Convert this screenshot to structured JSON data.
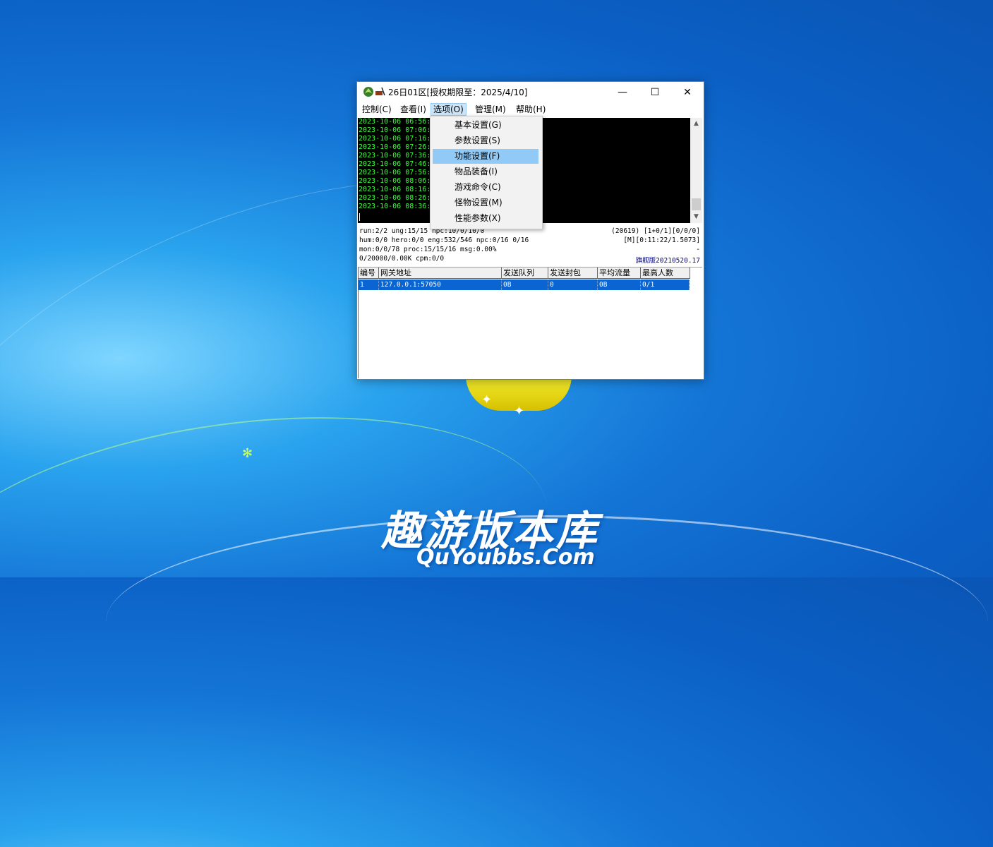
{
  "window": {
    "title": "26日01区[授权期限至：2025/4/10]",
    "minimize": "—",
    "maximize": "☐",
    "close": "✕"
  },
  "menubar": [
    {
      "label": "控制(C)"
    },
    {
      "label": "查看(I)"
    },
    {
      "label": "选项(O)"
    },
    {
      "label": "管理(M)"
    },
    {
      "label": "帮助(H)"
    }
  ],
  "dropdown": [
    {
      "label": "基本设置(G)"
    },
    {
      "label": "参数设置(S)"
    },
    {
      "label": "功能设置(F)"
    },
    {
      "label": "物品装备(I)"
    },
    {
      "label": "游戏命令(C)"
    },
    {
      "label": "怪物设置(M)"
    },
    {
      "label": "性能参数(X)"
    }
  ],
  "log": [
    "2023-10-06 06:56:",
    "2023-10-06 07:06:",
    "2023-10-06 07:16:",
    "2023-10-06 07:26:",
    "2023-10-06 07:36:",
    "2023-10-06 07:46:",
    "2023-10-06 07:56:",
    "2023-10-06 08:06:",
    "2023-10-06 08:16:",
    "2023-10-06 08:26:",
    "2023-10-06 08:36:"
  ],
  "status": {
    "line1_left": "run:2/2 ung:15/15 npc:10/0/10/0",
    "line1_right": "(20619) [1+0/1][0/0/0]",
    "line2_left": "hum:0/0 hero:0/0 eng:532/546 npc:0/16 0/16",
    "line2_right": "[M][0:11:22/1.5073]",
    "line3_left": "mon:0/0/78 proc:15/15/16 msg:0.00%",
    "line3_right": "-",
    "line4_left": "0/20000/0.00K cpm:0/0",
    "line4_right": "旗舰版20210520.17"
  },
  "grid": {
    "headers": [
      "编号",
      "网关地址",
      "发送队列",
      "发送封包",
      "平均流量",
      "最高人数"
    ],
    "rows": [
      [
        "1",
        "127.0.0.1:57050",
        "0B",
        "0",
        "0B",
        "0/1"
      ]
    ]
  },
  "watermark": {
    "cn": "趣游版本库",
    "en": "QuYoubbs.Com"
  }
}
